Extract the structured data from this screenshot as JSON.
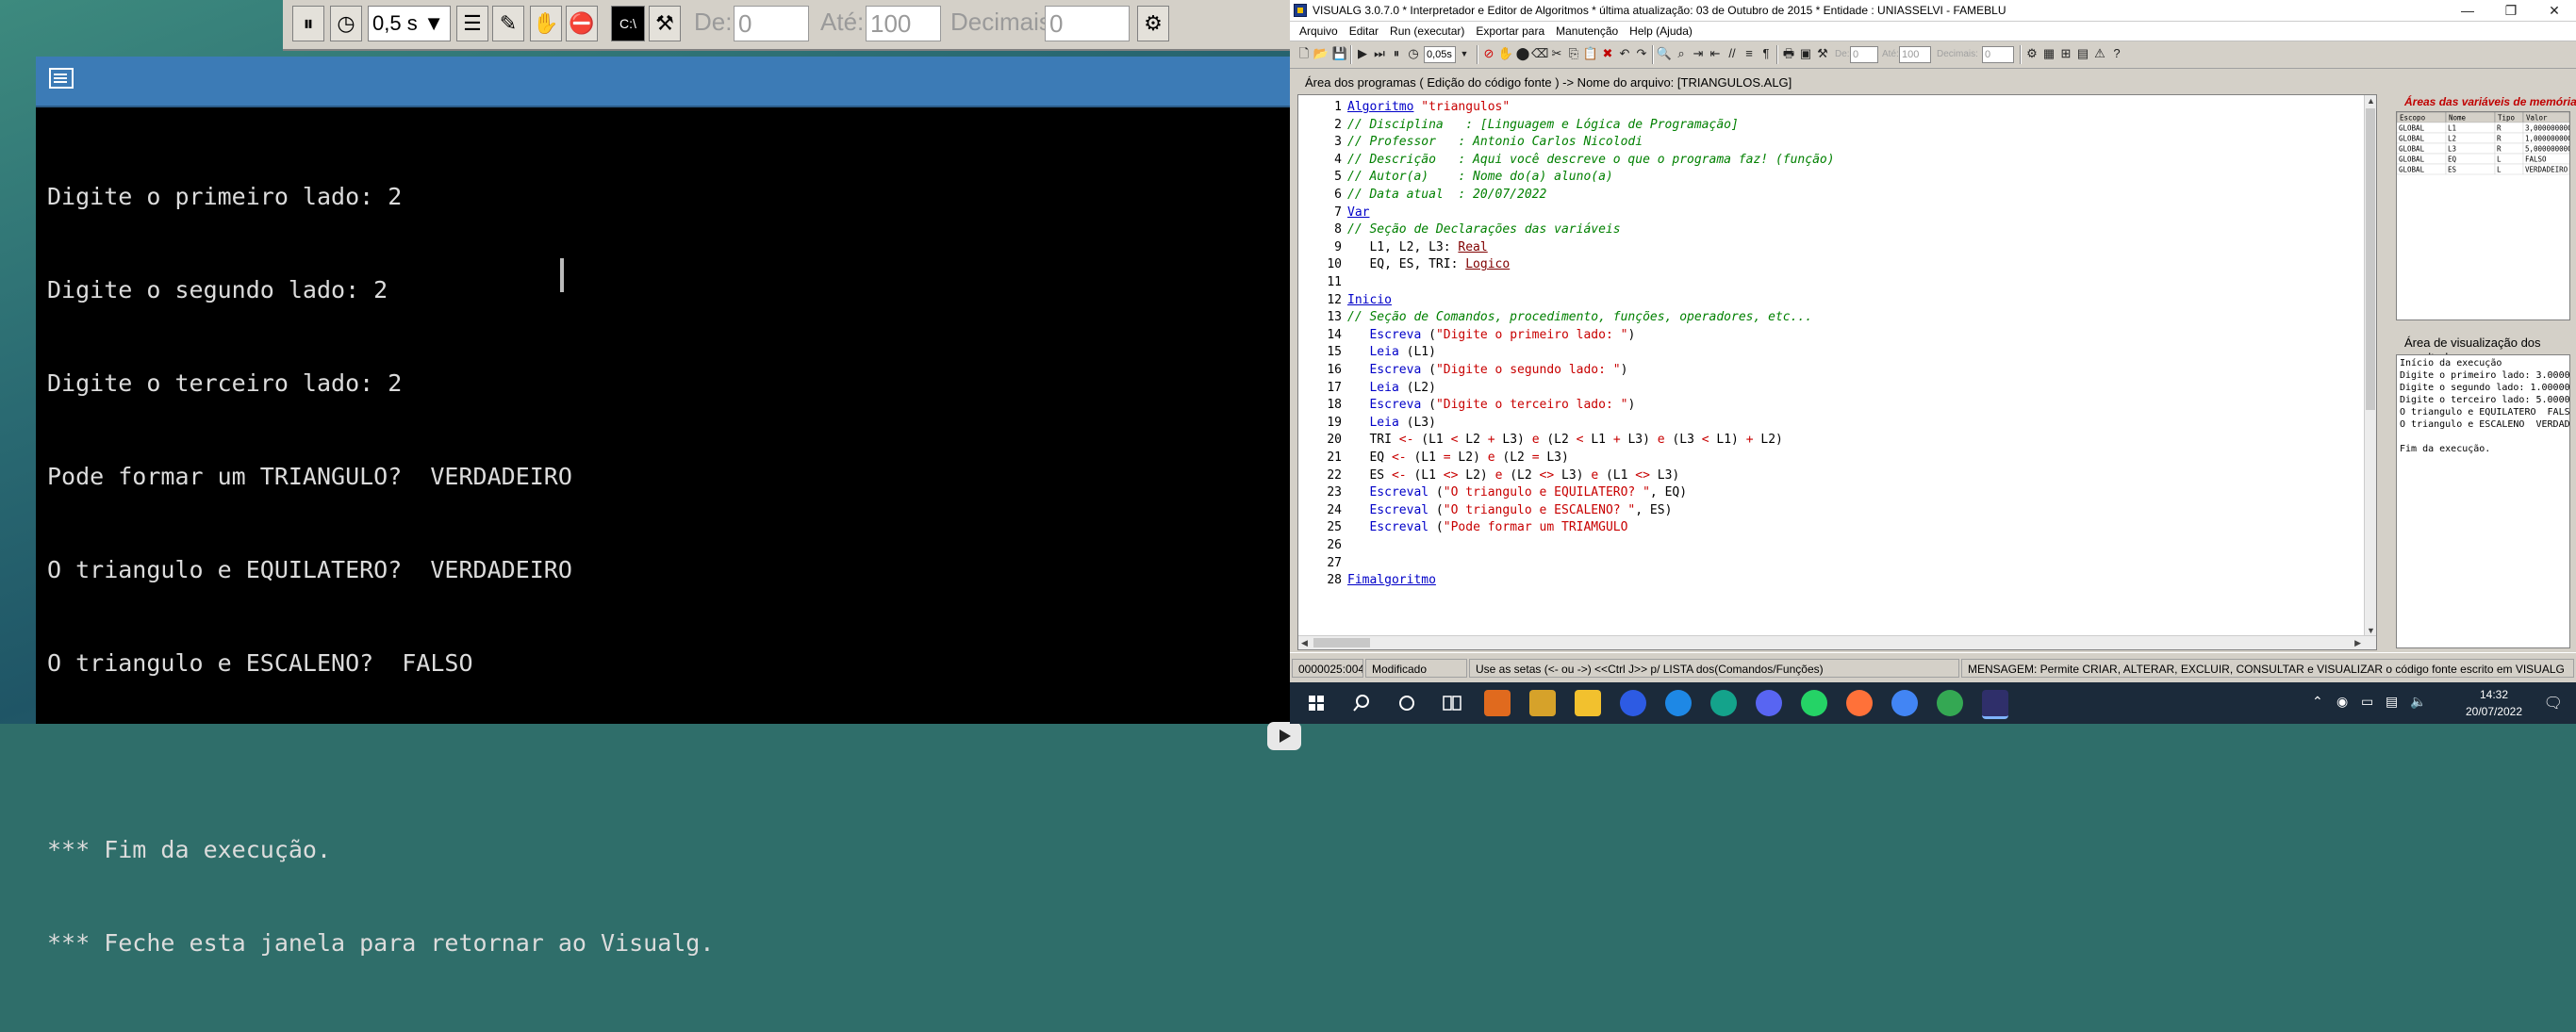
{
  "console": {
    "lines": [
      "Digite o primeiro lado: 2",
      "Digite o segundo lado: 2",
      "Digite o terceiro lado: 2",
      "Pode formar um TRIANGULO?  VERDADEIRO",
      "O triangulo e EQUILATERO?  VERDADEIRO",
      "O triangulo e ESCALENO?  FALSO",
      "",
      "*** Fim da execução.",
      "*** Feche esta janela para retornar ao Visualg."
    ]
  },
  "ghost_toolbar": {
    "speed": "0,5 s",
    "de_label": "De:",
    "de_value": "0",
    "ate_label": "Até:",
    "ate_value": "100",
    "decimais_label": "Decimais:",
    "decimais_value": "0"
  },
  "window": {
    "title": "VISUALG 3.0.7.0 * Interpretador e Editor de Algoritmos * última atualização: 03 de Outubro de 2015 * Entidade : UNIASSELVI - FAMEBLU"
  },
  "menu": [
    "Arquivo",
    "Editar",
    "Run (executar)",
    "Exportar para",
    "Manutenção",
    "Help (Ajuda)"
  ],
  "toolbar": {
    "speed": "0,05s",
    "de_label": "De:",
    "de_value": "0",
    "ate_label": "Até:",
    "ate_value": "100",
    "decimais_label": "Decimais:",
    "decimais_value": "0"
  },
  "editor": {
    "header": "Área dos programas ( Edição do código fonte ) -> Nome do arquivo: [TRIANGULOS.ALG]",
    "lines": [
      "Algoritmo \"triangulos\"",
      "// Disciplina   : [Linguagem e Lógica de Programação]",
      "// Professor   : Antonio Carlos Nicolodi",
      "// Descrição   : Aqui você descreve o que o programa faz! (função)",
      "// Autor(a)    : Nome do(a) aluno(a)",
      "// Data atual  : 20/07/2022",
      "Var",
      "// Seção de Declarações das variáveis",
      "   L1, L2, L3: Real",
      "   EQ, ES, TRI: Logico",
      "",
      "Inicio",
      "// Seção de Comandos, procedimento, funções, operadores, etc...",
      "   Escreva (\"Digite o primeiro lado: \")",
      "   Leia (L1)",
      "   Escreva (\"Digite o segundo lado: \")",
      "   Leia (L2)",
      "   Escreva (\"Digite o terceiro lado: \")",
      "   Leia (L3)",
      "   TRI <- (L1 < L2 + L3) e (L2 < L1 + L3) e (L3 < L1) + L2)",
      "   EQ <- (L1 = L2) e (L2 = L3)",
      "   ES <- (L1 <> L2) e (L2 <> L3) e (L1 <> L3)",
      "   Escreval (\"O triangulo e EQUILATERO? \", EQ)",
      "   Escreval (\"O triangulo e ESCALENO? \", ES)",
      "   Escreval (\"Pode formar um TRIAMGULO",
      "",
      "",
      "Fimalgoritmo"
    ]
  },
  "variables": {
    "header": "Áreas das variáveis de memória (Globais e Locais)",
    "columns": [
      "Escopo",
      "Nome",
      "Tipo",
      "Valor"
    ],
    "rows": [
      [
        "GLOBAL",
        "L1",
        "R",
        "3,00000000000000"
      ],
      [
        "GLOBAL",
        "L2",
        "R",
        "1,00000000000000"
      ],
      [
        "GLOBAL",
        "L3",
        "R",
        "5,00000000000000"
      ],
      [
        "GLOBAL",
        "EQ",
        "L",
        "FALSO"
      ],
      [
        "GLOBAL",
        "ES",
        "L",
        "VERDADEIRO"
      ]
    ]
  },
  "results": {
    "header": "Área de visualização dos resultados",
    "lines": [
      "Início da execução",
      "Digite o primeiro lado: 3.0000000000",
      "Digite o segundo lado: 1.0000000000",
      "Digite o terceiro lado: 5.0000000000",
      "O triangulo e EQUILATERO  FALSO",
      "O triangulo e ESCALENO  VERDADEIRO",
      "",
      "Fim da execução."
    ]
  },
  "status": {
    "position": "0000025:0040",
    "modified": "Modificado",
    "hint": "Use as setas (<- ou ->) <<Ctrl J>> p/ LISTA dos(Comandos/Funções)",
    "message": "MENSAGEM: Permite CRIAR, ALTERAR, EXCLUIR, CONSULTAR e VISUALIZAR o código fonte escrito em VISUALG"
  },
  "taskbar": {
    "time": "14:32",
    "date": "20/07/2022"
  },
  "colors": {
    "accent_header": "#c00000",
    "console_title": "#3c7bb6",
    "taskbar": "#1b2a3a"
  }
}
